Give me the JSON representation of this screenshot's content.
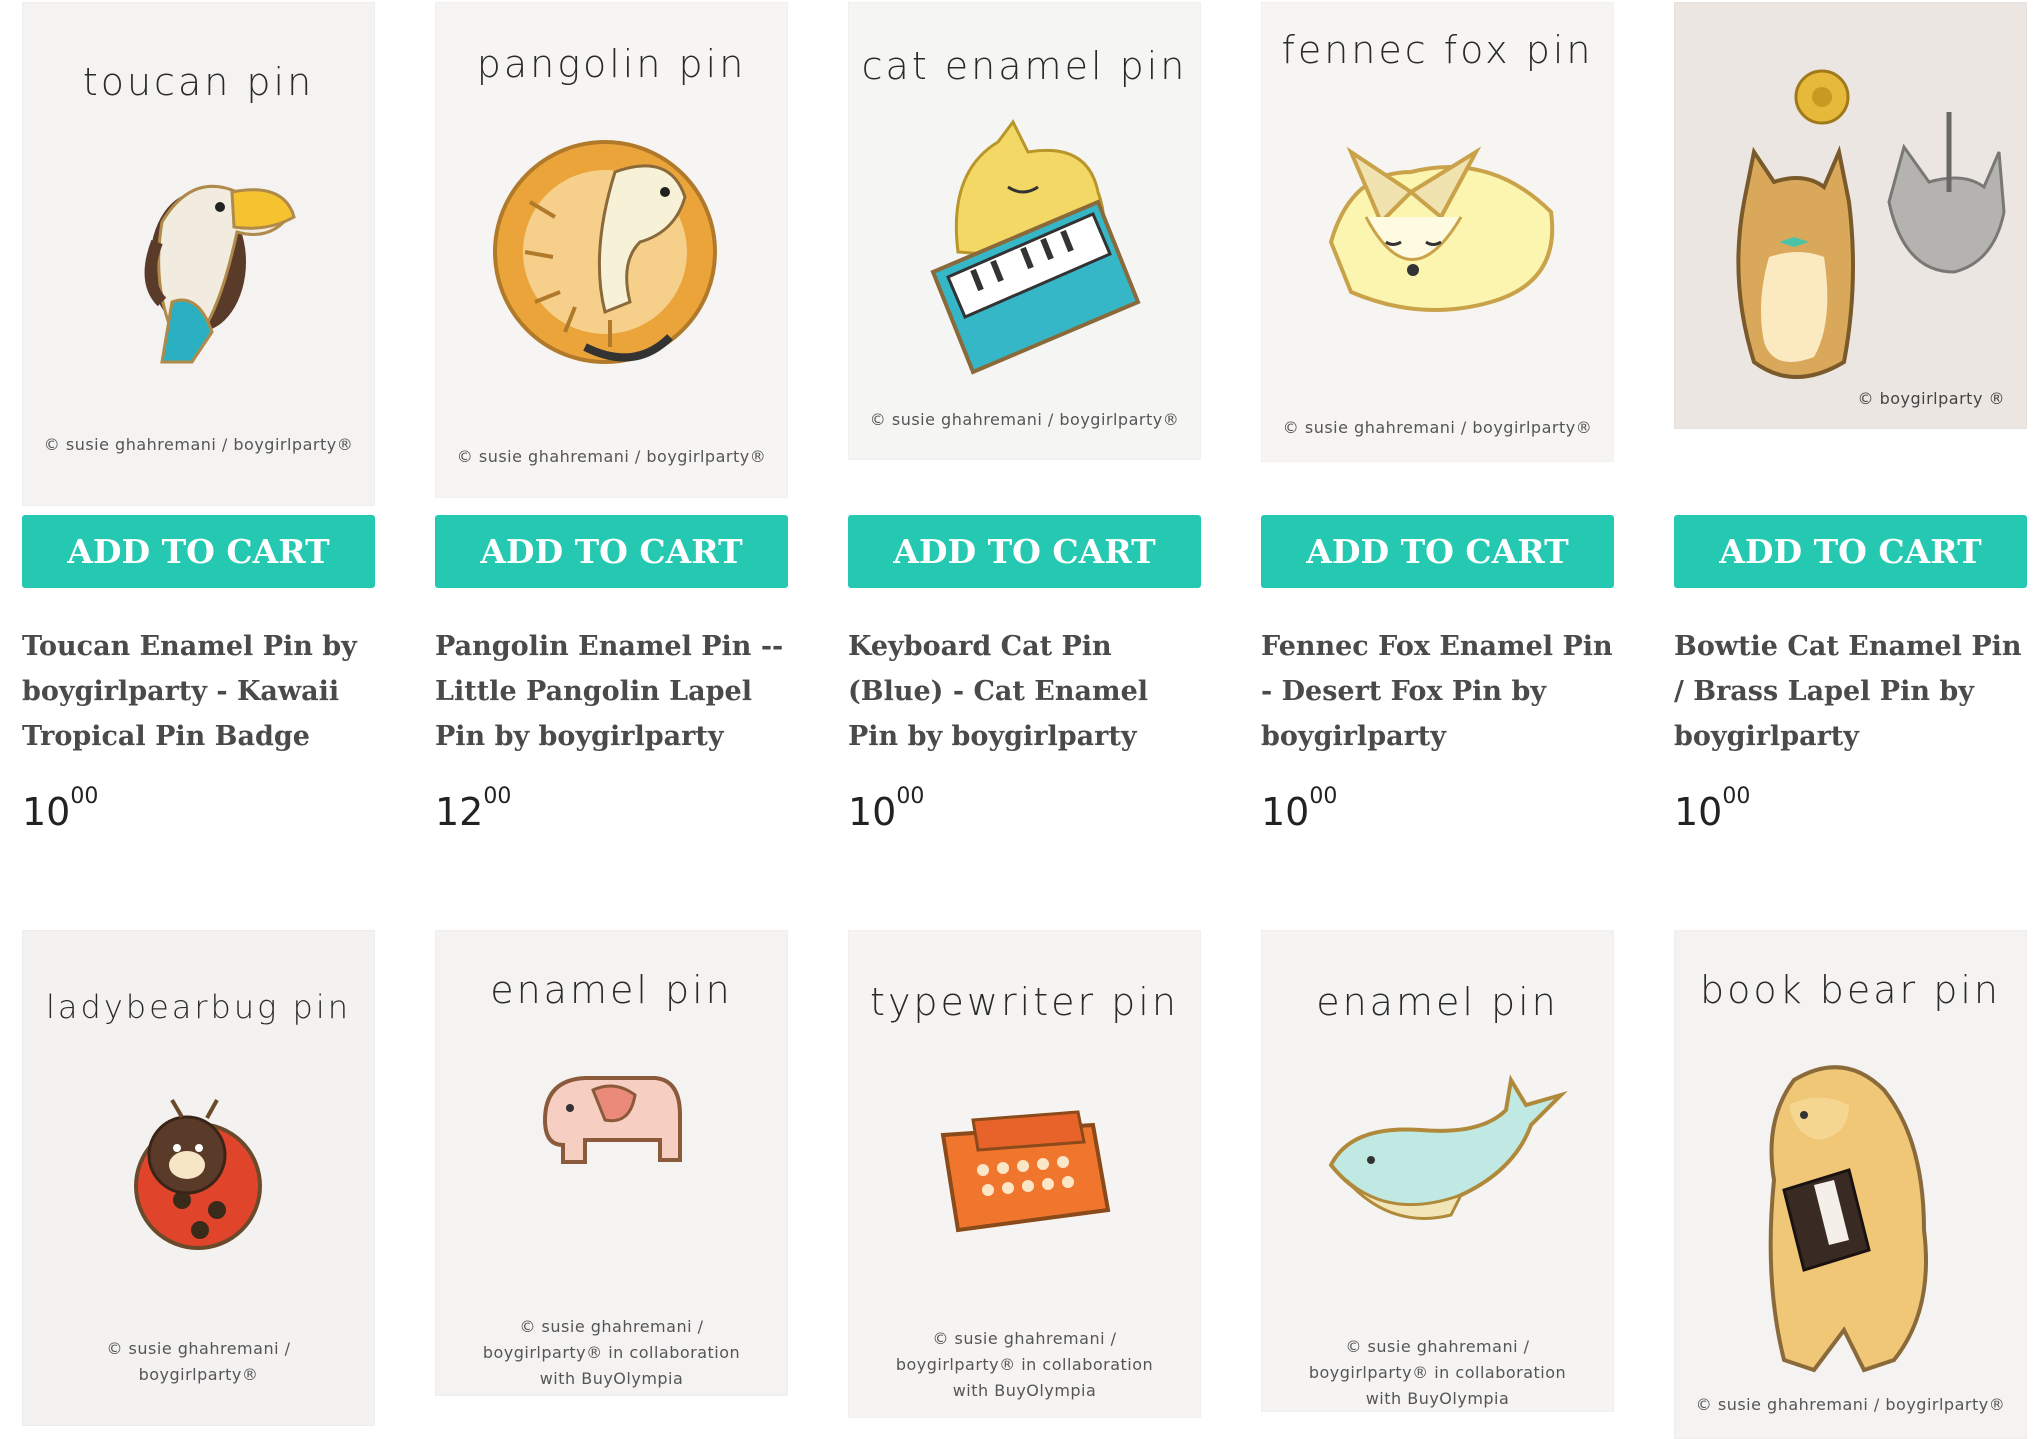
{
  "products": [
    {
      "caption": "toucan pin",
      "copyright": "© susie ghahremani / boygirlparty®",
      "button": "ADD TO CART",
      "name": "Toucan Enamel Pin by boygirlparty - Kawaii Tropical Pin Badge",
      "price_whole": "10",
      "price_cents": "00",
      "icon": "toucan-pin-icon"
    },
    {
      "caption": "pangolin pin",
      "copyright": "© susie ghahremani / boygirlparty®",
      "button": "ADD TO CART",
      "name": "Pangolin Enamel Pin -- Little Pangolin Lapel Pin by boygirlparty",
      "price_whole": "12",
      "price_cents": "00",
      "icon": "pangolin-pin-icon"
    },
    {
      "caption": "cat enamel pin",
      "copyright": "© susie ghahremani / boygirlparty®",
      "button": "ADD TO CART",
      "name": "Keyboard Cat Pin (Blue) - Cat Enamel Pin by boygirlparty",
      "price_whole": "10",
      "price_cents": "00",
      "icon": "keyboard-cat-pin-icon"
    },
    {
      "caption": "fennec fox pin",
      "copyright": "© susie ghahremani / boygirlparty®",
      "button": "ADD TO CART",
      "name": "Fennec Fox Enamel Pin - Desert Fox Pin by boygirlparty",
      "price_whole": "10",
      "price_cents": "00",
      "icon": "fennec-fox-pin-icon"
    },
    {
      "caption": "",
      "copyright": "© boygirlparty ®",
      "button": "ADD TO CART",
      "name": "Bowtie Cat Enamel Pin / Brass Lapel Pin by boygirlparty",
      "price_whole": "10",
      "price_cents": "00",
      "icon": "bowtie-cat-pin-icon"
    },
    {
      "caption": "ladybearbug pin",
      "copyright": "© susie ghahremani / boygirlparty®",
      "button": "",
      "name": "",
      "price_whole": "",
      "price_cents": "",
      "icon": "ladybearbug-pin-icon"
    },
    {
      "caption": "enamel pin",
      "copyright": "© susie ghahremani / boygirlparty® in collaboration with BuyOlympia",
      "button": "",
      "name": "",
      "price_whole": "",
      "price_cents": "",
      "icon": "elephant-pin-icon"
    },
    {
      "caption": "typewriter pin",
      "copyright": "© susie ghahremani / boygirlparty® in collaboration with BuyOlympia",
      "button": "",
      "name": "",
      "price_whole": "",
      "price_cents": "",
      "icon": "typewriter-pin-icon"
    },
    {
      "caption": "enamel pin",
      "copyright": "© susie ghahremani / boygirlparty® in collaboration with BuyOlympia",
      "button": "",
      "name": "",
      "price_whole": "",
      "price_cents": "",
      "icon": "whale-pin-icon"
    },
    {
      "caption": "book bear pin",
      "copyright": "© susie ghahremani / boygirlparty®",
      "button": "",
      "name": "",
      "price_whole": "",
      "price_cents": "",
      "icon": "book-bear-pin-icon"
    }
  ],
  "colors": {
    "button": "#25c9b2",
    "title": "#4a4a4a",
    "card_bg": "#f4f3f2"
  }
}
